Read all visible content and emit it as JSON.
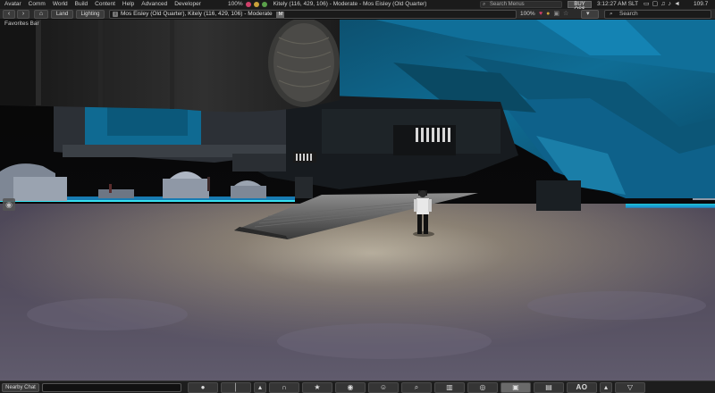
{
  "menu": {
    "items": [
      "Avatar",
      "Comm",
      "World",
      "Build",
      "Content",
      "Help",
      "Advanced",
      "Developer"
    ],
    "volume": "100%",
    "location_text": "Kitely (116, 429, 106) - Moderate - Mos Eisley (Old Quarter)",
    "search_placeholder": "Search Menus",
    "buy_label": "BUY OS$",
    "clock": "3:12:27 AM SLT",
    "fps": "109.7"
  },
  "nav": {
    "land_label": "Land",
    "lighting_label": "Lighting",
    "address": "Mos Eisley (Old Quarter), Kitely (116, 429, 106) - Moderate",
    "mature_badge": "M",
    "zoom": "100%",
    "search_placeholder": "Search"
  },
  "favorites_bar": "Favorites Bar",
  "bottom": {
    "chat_label": "Nearby Chat",
    "ao_label": "AO"
  },
  "icons": {
    "back": "back-icon",
    "forward": "forward-icon",
    "home": "home-icon",
    "search": "search-icon",
    "pin": "location-pin-icon"
  },
  "colors": {
    "menubar": "#1b1b1b",
    "navbar": "#2a2a2a",
    "ship_blue": "#0e6c94",
    "ground": "#6a6270",
    "neon": "#1fb7d2"
  }
}
